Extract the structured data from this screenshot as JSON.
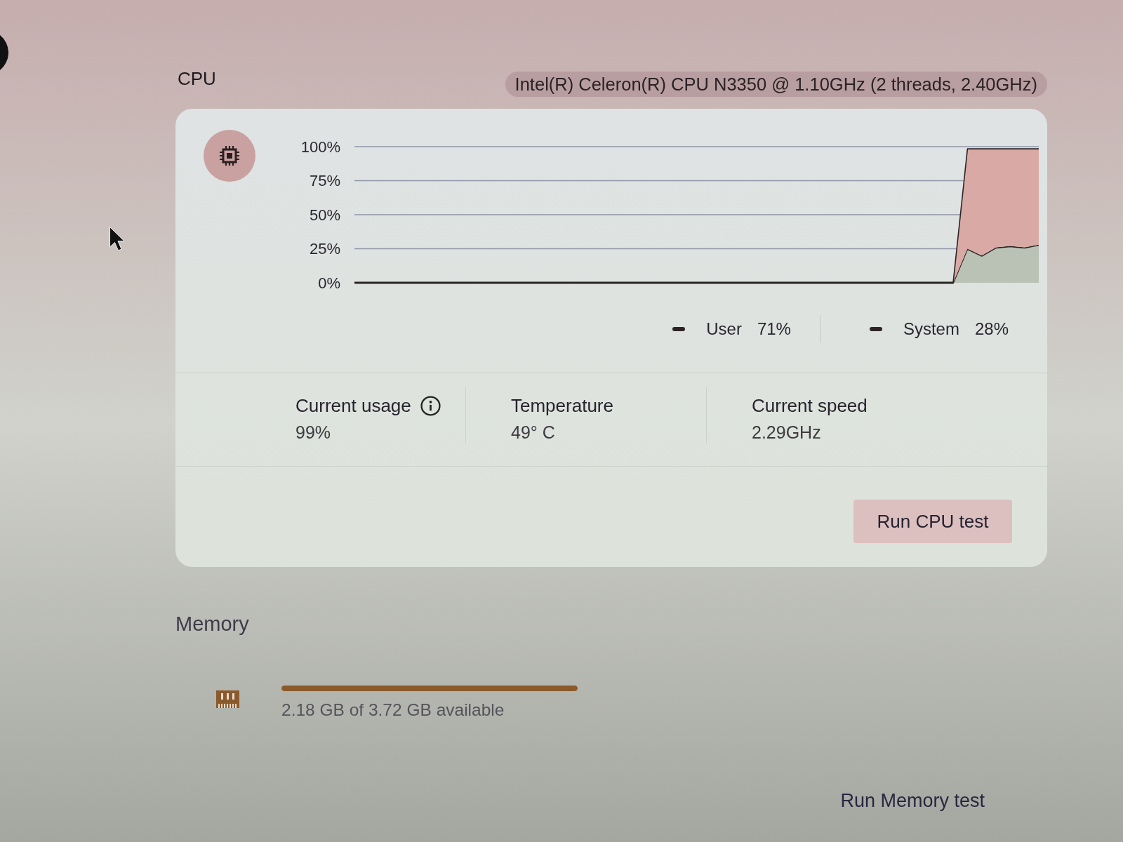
{
  "cpu": {
    "title": "CPU",
    "processor": "Intel(R) Celeron(R) CPU N3350 @ 1.10GHz (2 threads, 2.40GHz)",
    "chart_data": [
      {
        "type": "area",
        "stacked": true,
        "ylim": [
          0,
          100
        ],
        "yticks": [
          {
            "value": 0,
            "label": "0%"
          },
          {
            "value": 25,
            "label": "25%"
          },
          {
            "value": 50,
            "label": "50%"
          },
          {
            "value": 75,
            "label": "75%"
          },
          {
            "value": 100,
            "label": "100%"
          }
        ],
        "grid": true,
        "categories": [
          null,
          null,
          null,
          null,
          null,
          null,
          null,
          null,
          null,
          null,
          null,
          null,
          null,
          null,
          null,
          null,
          null,
          null,
          null,
          null,
          null,
          null,
          null,
          null,
          null,
          null,
          null,
          null,
          null,
          null,
          null,
          null,
          null,
          null,
          null,
          null,
          null,
          null,
          null,
          null,
          null,
          null,
          null,
          null,
          null,
          null,
          null,
          null,
          null
        ],
        "series": [
          {
            "name": "User",
            "color": "#d9aaa5",
            "values": [
              0,
              0,
              0,
              0,
              0,
              0,
              0,
              0,
              0,
              0,
              0,
              0,
              0,
              0,
              0,
              0,
              0,
              0,
              0,
              0,
              0,
              0,
              0,
              0,
              0,
              0,
              0,
              0,
              0,
              0,
              0,
              0,
              0,
              0,
              0,
              0,
              0,
              0,
              0,
              0,
              0,
              0,
              0,
              73,
              78,
              72,
              71,
              72,
              70
            ]
          },
          {
            "name": "System",
            "color": "#b9c2b5",
            "values": [
              0,
              0,
              0,
              0,
              0,
              0,
              0,
              0,
              0,
              0,
              0,
              0,
              0,
              0,
              0,
              0,
              0,
              0,
              0,
              0,
              0,
              0,
              0,
              0,
              0,
              0,
              0,
              0,
              0,
              0,
              0,
              0,
              0,
              0,
              0,
              0,
              0,
              0,
              0,
              0,
              0,
              0,
              0,
              25,
              20,
              26,
              27,
              26,
              28
            ]
          }
        ]
      }
    ],
    "legend_readings": [
      "71%",
      "28%"
    ],
    "stats": [
      {
        "label": "Current usage",
        "value": "99%",
        "info": true
      },
      {
        "label": "Temperature",
        "value": "49° C",
        "info": false
      },
      {
        "label": "Current speed",
        "value": "2.29GHz",
        "info": false
      }
    ],
    "run_test_button": "Run CPU test"
  },
  "memory": {
    "title": "Memory",
    "usage": {
      "level": 1,
      "text": "2.18 GB of 3.72 GB available"
    },
    "run_test_button": "Run Memory test"
  }
}
